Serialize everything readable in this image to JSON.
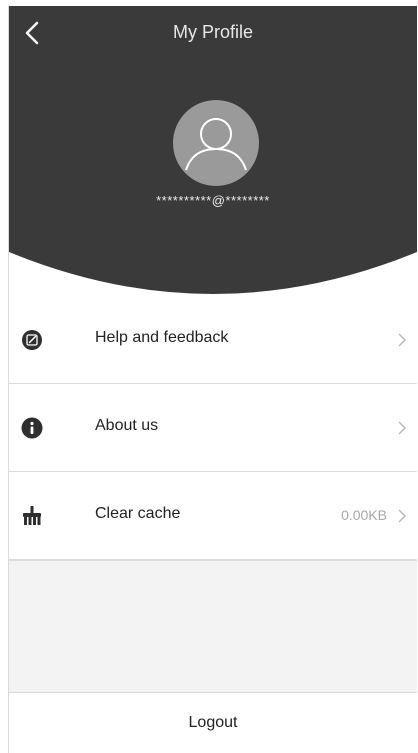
{
  "header": {
    "title": "My Profile",
    "back_icon": "chevron-left-icon",
    "avatar_icon": "user-avatar-icon",
    "email": "**********@********",
    "background_color": "#3a3a3a"
  },
  "menu": {
    "items": [
      {
        "label": "Help and feedback",
        "icon": "edit-icon",
        "value": "",
        "chevron": "chevron-right-icon"
      },
      {
        "label": "About us",
        "icon": "info-icon",
        "value": "",
        "chevron": "chevron-right-icon"
      },
      {
        "label": "Clear cache",
        "icon": "broom-icon",
        "value": "0.00KB",
        "chevron": "chevron-right-icon"
      }
    ]
  },
  "footer": {
    "logout_label": "Logout"
  }
}
